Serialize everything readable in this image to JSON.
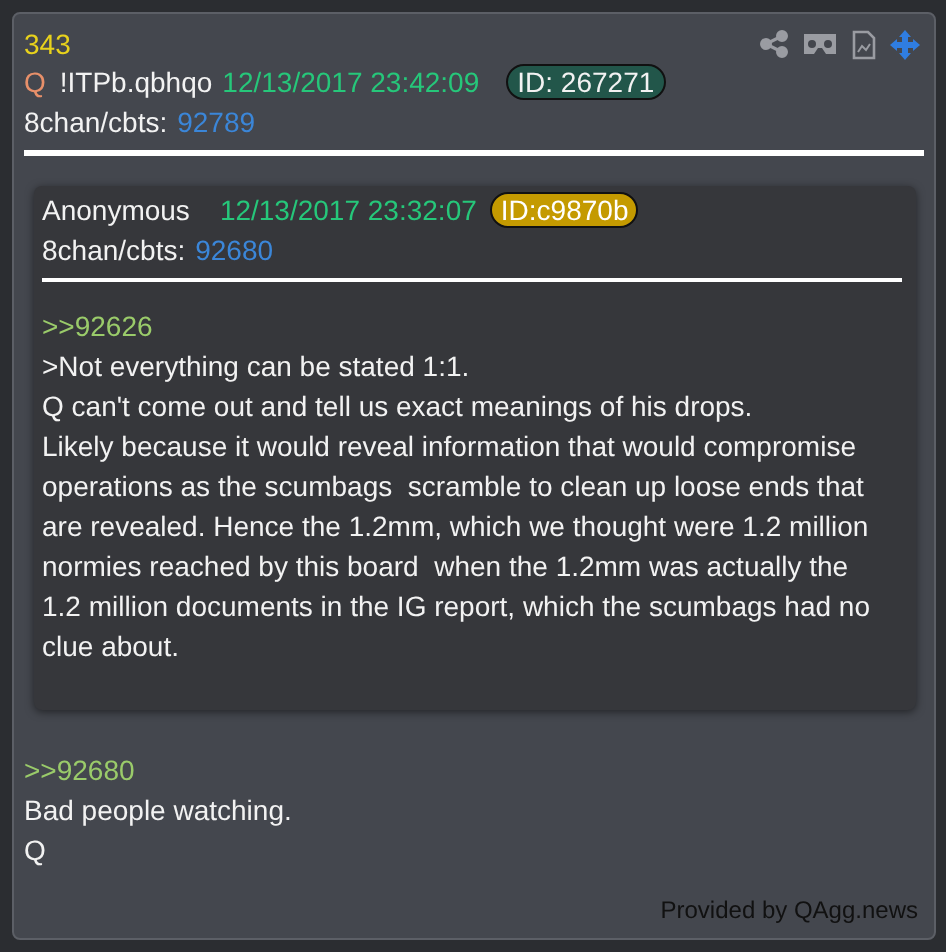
{
  "post": {
    "number": "343",
    "name": "Q",
    "tripcode": "!ITPb.qbhqo",
    "timestamp": "12/13/2017 23:42:09",
    "id": "ID: 267271",
    "board": "8chan/cbts:",
    "post_link": "92789"
  },
  "quoted_post": {
    "name": "Anonymous",
    "timestamp": "12/13/2017 23:32:07",
    "id": "ID:c9870b",
    "board": "8chan/cbts:",
    "post_link": "92680",
    "lines": [
      {
        "kind": "reply",
        "text": ">>92626"
      },
      {
        "kind": "text",
        "text": ">Not everything can be stated 1:1."
      },
      {
        "kind": "text",
        "text": "Q can't come out and tell us exact meanings of his drops."
      },
      {
        "kind": "text",
        "text": "Likely because it would reveal information that would compromise operations as the scumbags  scramble to clean up loose ends that are revealed. Hence the 1.2mm, which we thought were 1.2 million normies reached by this board  when the 1.2mm was actually the 1.2 million documents in the IG report, which the scumbags had no clue about."
      }
    ]
  },
  "body": [
    {
      "kind": "reply",
      "text": ">>92680"
    },
    {
      "kind": "text",
      "text": "Bad people watching."
    },
    {
      "kind": "text",
      "text": "Q"
    }
  ],
  "footer": "Provided by QAgg.news"
}
